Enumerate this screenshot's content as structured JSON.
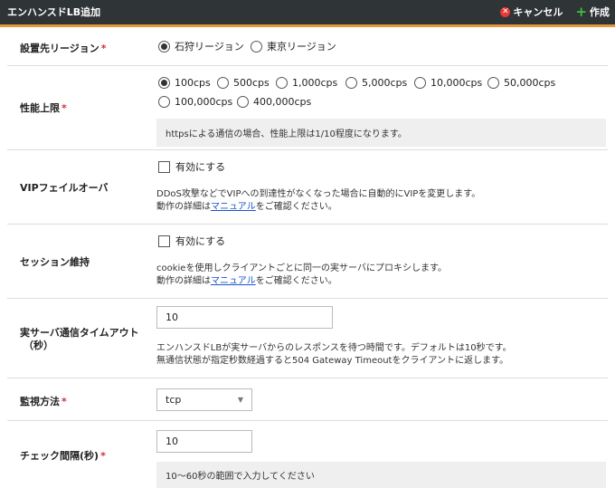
{
  "header": {
    "title": "エンハンスドLB追加",
    "cancel_label": "キャンセル",
    "create_label": "作成"
  },
  "region": {
    "label": "設置先リージョン",
    "required": "*",
    "options": [
      "石狩リージョン",
      "東京リージョン"
    ],
    "selected": "石狩リージョン"
  },
  "performance": {
    "label": "性能上限",
    "required": "*",
    "options": [
      "100cps",
      "500cps",
      "1,000cps",
      "5,000cps",
      "10,000cps",
      "50,000cps",
      "100,000cps",
      "400,000cps"
    ],
    "selected": "100cps",
    "note": "httpsによる通信の場合、性能上限は1/10程度になります。"
  },
  "vip_failover": {
    "label": "VIPフェイルオーバ",
    "checkbox_label": "有効にする",
    "desc_line1": "DDoS攻撃などでVIPへの到達性がなくなった場合に自動的にVIPを変更します。",
    "desc_prefix": "動作の詳細は",
    "desc_link": "マニュアル",
    "desc_suffix": "をご確認ください。"
  },
  "session": {
    "label": "セッション維持",
    "checkbox_label": "有効にする",
    "desc_line1": "cookieを使用しクライアントごとに同一の実サーバにプロキシします。",
    "desc_prefix": "動作の詳細は",
    "desc_link": "マニュアル",
    "desc_suffix": "をご確認ください。"
  },
  "timeout": {
    "label_line1": "実サーバ通信タイムアウト",
    "label_line2": "（秒）",
    "value": "10",
    "desc_line1": "エンハンスドLBが実サーバからのレスポンスを待つ時間です。デフォルトは10秒です。",
    "desc_line2": "無通信状態が指定秒数経過すると504 Gateway Timeoutをクライアントに返します。"
  },
  "monitor": {
    "label": "監視方法",
    "required": "*",
    "selected": "tcp"
  },
  "interval": {
    "label": "チェック間隔(秒)",
    "required": "*",
    "value": "10",
    "note": "10～60秒の範囲で入力してください"
  }
}
